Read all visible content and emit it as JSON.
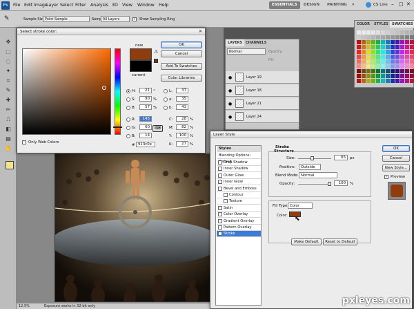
{
  "menubar": {
    "app_badge": "Ps",
    "items": [
      "File",
      "Edit",
      "Image",
      "Layer",
      "Select",
      "Filter",
      "Analysis",
      "3D",
      "View",
      "Window",
      "Help"
    ],
    "workspaces": [
      "ESSENTIALS",
      "DESIGN",
      "PAINTING"
    ],
    "cs_live": "CS Live"
  },
  "optionsbar": {
    "sample_size_label": "Sample Size:",
    "sample_size_value": "Point Sample",
    "sample_label": "Sample:",
    "sample_value": "All Layers",
    "show_ring_label": "Show Sampling Ring"
  },
  "color_picker": {
    "title": "Select stroke color:",
    "ok": "OK",
    "cancel": "Cancel",
    "add_to_swatches": "Add To Swatches",
    "color_libraries": "Color Libraries",
    "new_label": "new",
    "current_label": "current",
    "new_color": "#913c0e",
    "current_color": "#000000",
    "only_web_colors": "Only Web Colors",
    "fields": [
      {
        "label": "H:",
        "value": "21",
        "unit": "°"
      },
      {
        "label": "S:",
        "value": "90",
        "unit": "%"
      },
      {
        "label": "B:",
        "value": "57",
        "unit": "%"
      },
      {
        "label": "R:",
        "value": "145",
        "unit": ""
      },
      {
        "label": "G:",
        "value": "60",
        "unit": ""
      },
      {
        "label": "B:",
        "value": "14",
        "unit": ""
      }
    ],
    "lab_fields": [
      {
        "label": "L:",
        "value": "37"
      },
      {
        "label": "a:",
        "value": "35"
      },
      {
        "label": "b:",
        "value": "43"
      }
    ],
    "cmyk_fields": [
      {
        "label": "C:",
        "value": "28",
        "unit": "%"
      },
      {
        "label": "M:",
        "value": "82",
        "unit": "%"
      },
      {
        "label": "Y:",
        "value": "100",
        "unit": "%"
      },
      {
        "label": "K:",
        "value": "27",
        "unit": "%"
      }
    ],
    "hex_label": "#",
    "hex_value": "913c0e"
  },
  "layers_panel": {
    "tabs": [
      "LAYERS",
      "CHANNELS"
    ],
    "blend_mode": "Normal",
    "opacity_label": "Opacity:",
    "fill_label": "Fill:",
    "layers": [
      "Layer 19",
      "Layer 18",
      "Layer 21",
      "Layer 24"
    ]
  },
  "swatches_panel": {
    "tabs": [
      "COLOR",
      "STYLES",
      "SWATCHES"
    ]
  },
  "layer_style": {
    "title": "Layer Style",
    "styles_header": "Styles",
    "blending_options": "Blending Options: Default",
    "effects": [
      {
        "name": "Drop Shadow",
        "checked": false
      },
      {
        "name": "Inner Shadow",
        "checked": false
      },
      {
        "name": "Outer Glow",
        "checked": false
      },
      {
        "name": "Inner Glow",
        "checked": false
      },
      {
        "name": "Bevel and Emboss",
        "checked": false
      },
      {
        "name": "Contour",
        "checked": false
      },
      {
        "name": "Texture",
        "checked": false
      },
      {
        "name": "Satin",
        "checked": false
      },
      {
        "name": "Color Overlay",
        "checked": false
      },
      {
        "name": "Gradient Overlay",
        "checked": false
      },
      {
        "name": "Pattern Overlay",
        "checked": false
      },
      {
        "name": "Stroke",
        "checked": true
      }
    ],
    "stroke_header": "Stroke",
    "structure_header": "Structure",
    "size_label": "Size:",
    "size_value": "65",
    "size_unit": "px",
    "position_label": "Position:",
    "position_value": "Outside",
    "blend_mode_label": "Blend Mode:",
    "blend_mode_value": "Normal",
    "opacity_label": "Opacity:",
    "opacity_value": "100",
    "opacity_unit": "%",
    "fill_type_label": "Fill Type:",
    "fill_type_value": "Color",
    "color_label": "Color:",
    "stroke_color": "#913c0e",
    "make_default": "Make Default",
    "reset_to_default": "Reset to Default",
    "ok": "OK",
    "cancel": "Cancel",
    "new_style": "New Style...",
    "preview_label": "Preview",
    "preview_checked": true
  },
  "status": {
    "zoom": "12.5%",
    "message": "Exposure works in 32-bit only"
  },
  "watermark": "pxleyes.com"
}
